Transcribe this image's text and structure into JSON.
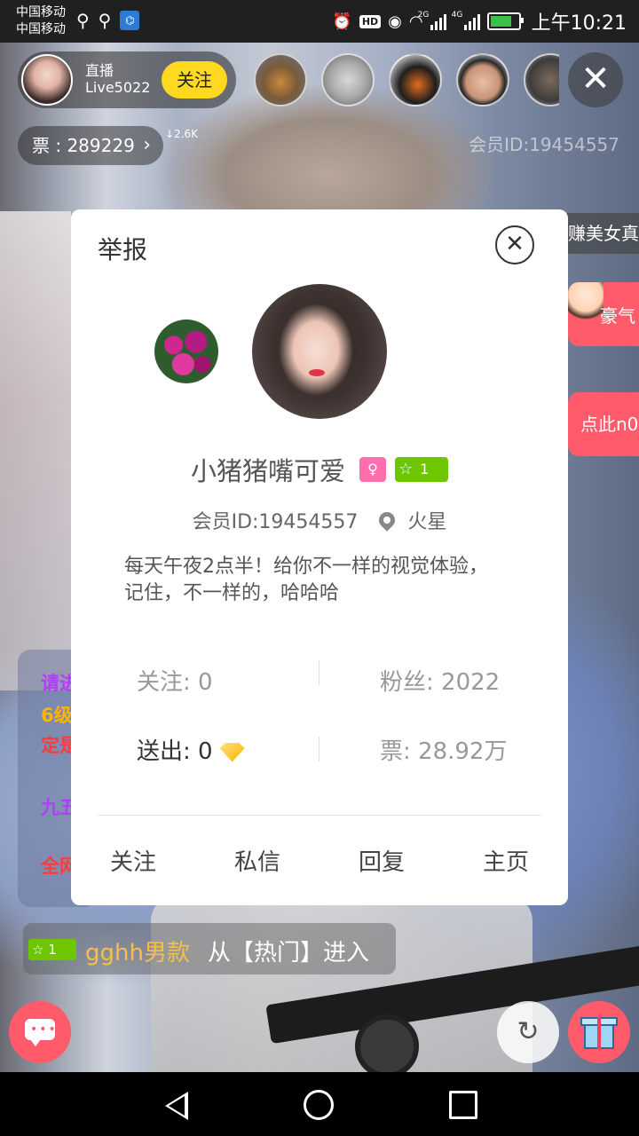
{
  "status_bar": {
    "carrier_1": "中国移动",
    "carrier_2": "中国移动",
    "time": "上午10:21",
    "hd_label": "HD",
    "net_2g": "2G",
    "net_4g": "4G"
  },
  "host": {
    "name": "直播Live5022",
    "follow_label": "关注",
    "tickets_label": "票 : 289229",
    "rank_delta": "↓2.6K",
    "member_id": "会员ID:19454557"
  },
  "right_banners": {
    "ad_text": "赚美女真",
    "haoqi": "豪气",
    "click_here": "点此n0"
  },
  "chat_panel": {
    "line_1": "请进",
    "line_2": "6级",
    "line_3": "定是",
    "line_4": "九五",
    "line_5": "全网"
  },
  "dialog": {
    "title": "举报",
    "nickname": "小猪猪嘴可爱",
    "gender_icon": "female-icon",
    "level": "1",
    "member_id": "会员ID:19454557",
    "location": "火星",
    "bio": "每天午夜2点半！给你不一样的视觉体验，记住，不一样的，哈哈哈",
    "stats": {
      "following": "关注: 0",
      "fans": "粉丝: 2022",
      "sent": "送出: 0",
      "tickets": "票: 28.92万"
    },
    "actions": {
      "follow": "关注",
      "message": "私信",
      "reply": "回复",
      "homepage": "主页"
    }
  },
  "entry_notice": {
    "level": "1",
    "user": "gghh男款",
    "text": "从【热门】进入"
  },
  "colors": {
    "accent_yellow": "#ffd81f",
    "accent_pink": "#ff5b6b",
    "level_green": "#6dc600",
    "gender_pink": "#ff6fb0"
  }
}
